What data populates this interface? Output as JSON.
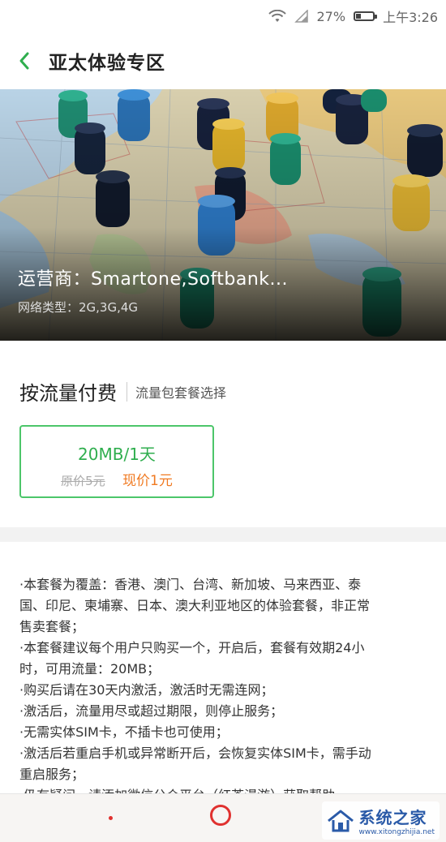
{
  "status_bar": {
    "battery": "27%",
    "time": "上午3:26"
  },
  "header": {
    "title": "亚太体验专区"
  },
  "banner": {
    "operator": "运营商：Smartone,Softbank...",
    "network_type": "网络类型：2G,3G,4G"
  },
  "pay": {
    "title": "按流量付费",
    "subtitle": "流量包套餐选择",
    "plan": {
      "name": "20MB/1天",
      "original_price": "原价5元",
      "current_price": "现价1元"
    }
  },
  "description": {
    "lines": [
      "·本套餐为覆盖：香港、澳门、台湾、新加坡、马来西亚、泰",
      "国、印尼、柬埔寨、日本、澳大利亚地区的体验套餐，非正常",
      "售卖套餐；",
      "·本套餐建议每个用户只购买一个，开启后，套餐有效期24小",
      "时，可用流量：20MB；",
      "·购买后请在30天内激活，激活时无需连网；",
      "·激活后，流量用尽或超过期限，则停止服务；",
      "·无需实体SIM卡，不插卡也可使用；",
      "·激活后若重启手机或异常断开后，会恢复实体SIM卡，需手动",
      "重启服务；",
      "·仍有疑问，请添加微信公众平台（红茶漫游）获取帮助"
    ]
  },
  "watermark": {
    "text": "系统之家",
    "url": "www.xitongzhijia.net"
  },
  "colors": {
    "accent_green": "#2fae4e",
    "price_orange": "#f07a22",
    "nav_red": "#e0312f"
  }
}
